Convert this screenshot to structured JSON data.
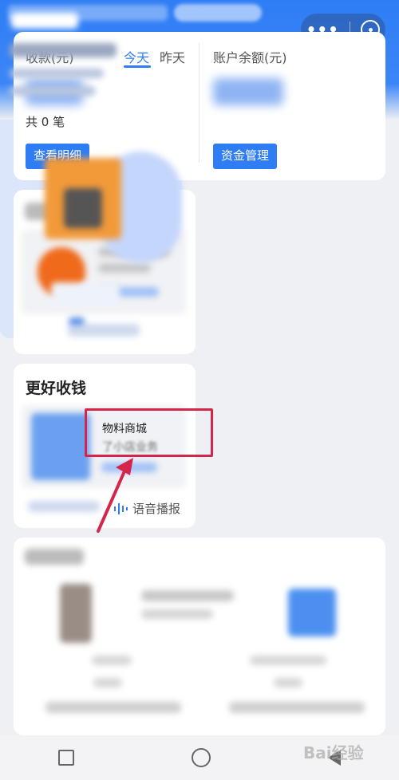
{
  "summary": {
    "income_label": "收款(元)",
    "tab_today": "今天",
    "tab_yesterday": "昨天",
    "balance_label": "账户余额(元)",
    "count_text": "共 0 笔",
    "detail_button": "查看明细",
    "fund_button": "资金管理"
  },
  "better_payment": {
    "title": "更好收钱",
    "popup_title": "物料商城",
    "popup_subtitle": "了小店业务"
  },
  "voice": {
    "label": "语音播报"
  },
  "watermark": {
    "text": "Bai经验"
  },
  "colors": {
    "accent": "#2f7df5",
    "highlight_box": "#d6254a",
    "right_card_bg": "#dbe6fb"
  }
}
